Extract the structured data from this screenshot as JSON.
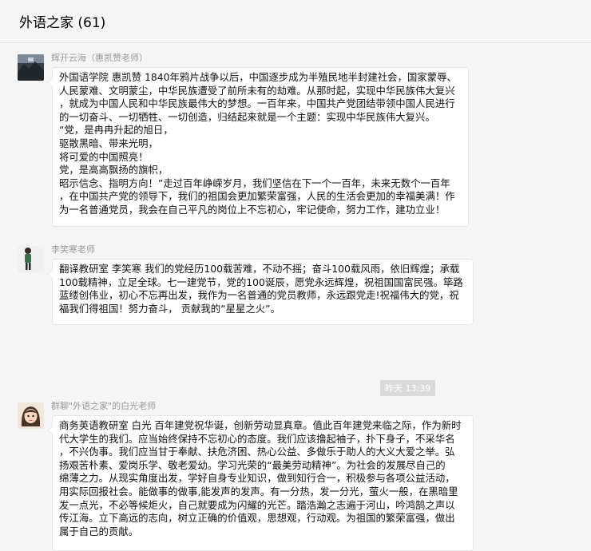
{
  "header": {
    "title": "外语之家 (61)"
  },
  "messages": [
    {
      "sender": "辉开云海（惠凯赞老师）",
      "avatar_icon": "landscape-avatar-icon",
      "lines": [
        "外国语学院  惠凯赞  1840年鸦片战争以后，中国逐步成为半殖民地半封建社会，国家蒙辱、",
        "人民蒙难、文明蒙尘，中华民族遭受了前所未有的劫难。从那时起，实现中华民族伟大复兴",
        "，就成为中国人民和中华民族最伟大的梦想。一百年来，中国共产党团结带领中国人民进行",
        "的一切奋斗、一切牺牲、一切创造，归结起来就是一个主题：实现中华民族伟大复兴。",
        "“党，是冉冉升起的旭日，",
        "驱散黑暗、带来光明，",
        "将可爱的中国照亮！",
        "党，是高高飘扬的旗帜，",
        "昭示信念、指明方向！”走过百年峥嵘岁月，我们坚信在下一个一百年，未来无数个一百年",
        "，在中国共产党的领导下，我们的祖国会更加繁荣富强，人民的生活会更加的幸福美满！作",
        "为一名普通党员，我会在自己平凡的岗位上不忘初心，牢记使命，努力工作，建功立业！"
      ]
    },
    {
      "sender": "李笑寒老师",
      "avatar_icon": "cartoon-figure-avatar-icon",
      "lines": [
        "翻译教研室  李笑寒  我们的党经历100载苦难，不动不摇；奋斗100载风雨，依旧辉煌；承载",
        "100载精神，立足全球。七一建党节，党的100诞辰，愿党永远辉煌，祝祖国国富民强。筚路",
        "蓝缕创伟业，初心不忘再出发，我作为一名普通的党员教师，永远跟党走!祝福伟大的党，祝",
        "福我们得祖国！努力奋斗， 贡献我的“星星之火”。"
      ]
    },
    {
      "sender": "群聊\"外语之家\"的白光老师",
      "avatar_icon": "girl-avatar-icon",
      "lines": [
        "商务英语教研室 白光 百年建党祝华诞，创新劳动显真章。值此百年建党来临之际，作为新时",
        "代大学生的我们。应当始终保持不忘初心的态度。我们应该撸起袖子，扑下身子，不采华名",
        "，不兴伪事。我们应当甘于奉献、扶危济困、热心公益、多做乐于助人的大义大爱之举。弘",
        "扬艰苦朴素、爱岗乐学、敬老爱幼。学习光荣的“最美劳动精神”。为社会的发展尽自己的",
        "绵薄之力。从现实角度出发，学好自身专业知识，做到知行合一，积极参与各项公益活动，",
        "用实际回报社会。能做事的做事,能发声的发声。有一分热，发一分光，萤火一般，在黑暗里",
        "发一点光，不必等候炬火，自己就要成为闪耀的光芒。踏浩瀚之志遍于河山，吟鸿鹄之声以",
        "传江海。立下高远的志向，树立正确的价值观，思想观，行动观。为祖国的繁荣富强，做出",
        "属于自己的贡献。"
      ]
    }
  ],
  "timestamp": "昨天 13:39"
}
